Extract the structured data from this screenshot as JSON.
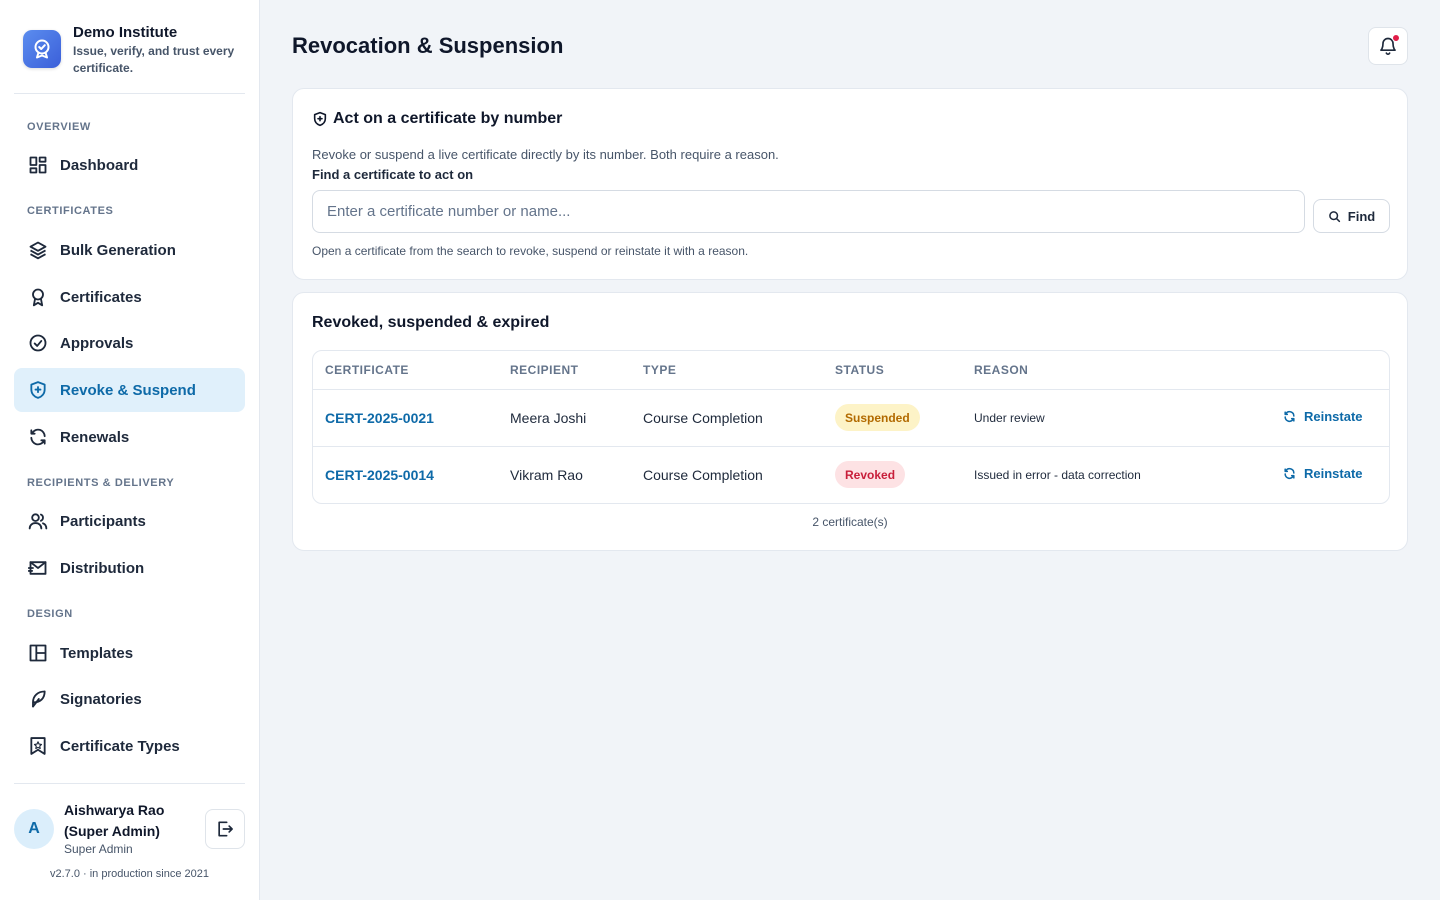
{
  "brand": {
    "name": "Demo Institute",
    "tagline": "Issue, verify, and trust every certificate."
  },
  "sidebar": {
    "sections": {
      "overview": "OVERVIEW",
      "certificates": "CERTIFICATES",
      "recipients": "RECIPIENTS & DELIVERY",
      "design": "DESIGN"
    },
    "items": {
      "dashboard": "Dashboard",
      "bulk_generation": "Bulk Generation",
      "certificates": "Certificates",
      "approvals": "Approvals",
      "revoke_suspend": "Revoke & Suspend",
      "renewals": "Renewals",
      "participants": "Participants",
      "distribution": "Distribution",
      "templates": "Templates",
      "signatories": "Signatories",
      "certificate_types": "Certificate Types"
    },
    "active": "revoke_suspend"
  },
  "user": {
    "initial": "A",
    "name": "Aishwarya Rao (Super Admin)",
    "role": "Super Admin",
    "version": "v2.7.0 · in production since 2021"
  },
  "page": {
    "title": "Revocation & Suspension"
  },
  "act_card": {
    "title": "Act on a certificate by number",
    "description": "Revoke or suspend a live certificate directly by its number. Both require a reason.",
    "field_label": "Find a certificate to act on",
    "placeholder": "Enter a certificate number or name...",
    "find_label": "Find",
    "hint": "Open a certificate from the search to revoke, suspend or reinstate it with a reason."
  },
  "list_card": {
    "title": "Revoked, suspended & expired",
    "columns": [
      "CERTIFICATE",
      "RECIPIENT",
      "TYPE",
      "STATUS",
      "REASON"
    ],
    "rows": [
      {
        "certificate": "CERT-2025-0021",
        "recipient": "Meera Joshi",
        "type": "Course Completion",
        "status": "Suspended",
        "reason": "Under review",
        "action": "Reinstate"
      },
      {
        "certificate": "CERT-2025-0014",
        "recipient": "Vikram Rao",
        "type": "Course Completion",
        "status": "Revoked",
        "reason": "Issued in error - data correction",
        "action": "Reinstate"
      }
    ],
    "count": "2 certificate(s)"
  },
  "colors": {
    "accent": "#0e6aa8",
    "suspended": "#b26a00",
    "revoked": "#c81e3a",
    "notification": "#e11d48"
  }
}
